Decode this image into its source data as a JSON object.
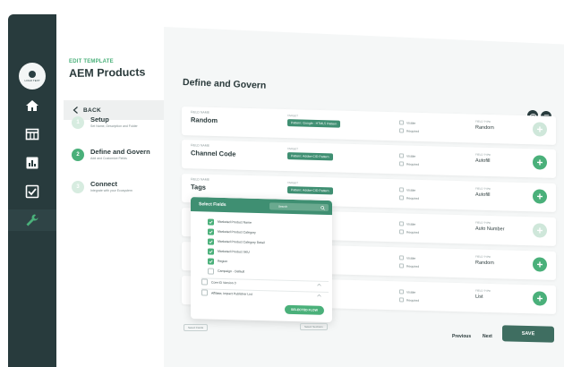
{
  "brand": {
    "logo_text": "LOGO TEXT"
  },
  "sidebar": {
    "items": [
      {
        "icon": "home-icon"
      },
      {
        "icon": "table-icon"
      },
      {
        "icon": "chart-icon"
      },
      {
        "icon": "checklist-icon"
      },
      {
        "icon": "wrench-icon",
        "active": true
      }
    ]
  },
  "template": {
    "label": "EDIT TEMPLATE",
    "title": "AEM Products",
    "back_label": "BACK",
    "steps": [
      {
        "num": "1",
        "title": "Setup",
        "subtitle": "Set Name, Description and Folder"
      },
      {
        "num": "2",
        "title": "Define and Govern",
        "subtitle": "Add and Customize Fields"
      },
      {
        "num": "3",
        "title": "Connect",
        "subtitle": "Integrate with your Ecosystem"
      }
    ]
  },
  "main": {
    "title": "Define and Govern",
    "field_name_label": "FIELD NAME",
    "template_label": "TARGET",
    "field_type_label": "FIELD TYPE",
    "visible_label": "Visible",
    "required_label": "Required",
    "rows": [
      {
        "name": "Random",
        "template": "Pattern: Google - HTML5 Pattern",
        "field_type": "Random"
      },
      {
        "name": "Channel Code",
        "template": "Pattern: Adobe-CID Pattern",
        "field_type": "Autofill"
      },
      {
        "name": "Tags",
        "template": "Pattern: Adobe-CID Pattern",
        "field_type": "Autofill"
      },
      {
        "name": "",
        "template": "",
        "field_type": "Auto Number"
      },
      {
        "name": "",
        "template": "",
        "field_type": "Random"
      },
      {
        "name": "",
        "template": "",
        "field_type": "List"
      }
    ],
    "select_fields_link": "Select Fields",
    "select_sections_link": "Select Sections",
    "prev_label": "Previous",
    "next_label": "Next",
    "save_label": "SAVE"
  },
  "popup": {
    "title": "Select Fields",
    "search_placeholder": "Search",
    "options": [
      {
        "label": "Marketed Product Name",
        "checked": true
      },
      {
        "label": "Marketed Product Category",
        "checked": true
      },
      {
        "label": "Marketed Product Category Detail",
        "checked": true
      },
      {
        "label": "Marketed Product SKU",
        "checked": true
      },
      {
        "label": "Region",
        "checked": true
      },
      {
        "label": "Campaign - Default",
        "checked": false
      }
    ],
    "groups": [
      {
        "label": "Core ID Version 3"
      },
      {
        "label": "Affiliate, Impact Publisher List"
      }
    ],
    "button_label": "SELECTED FLOW"
  }
}
